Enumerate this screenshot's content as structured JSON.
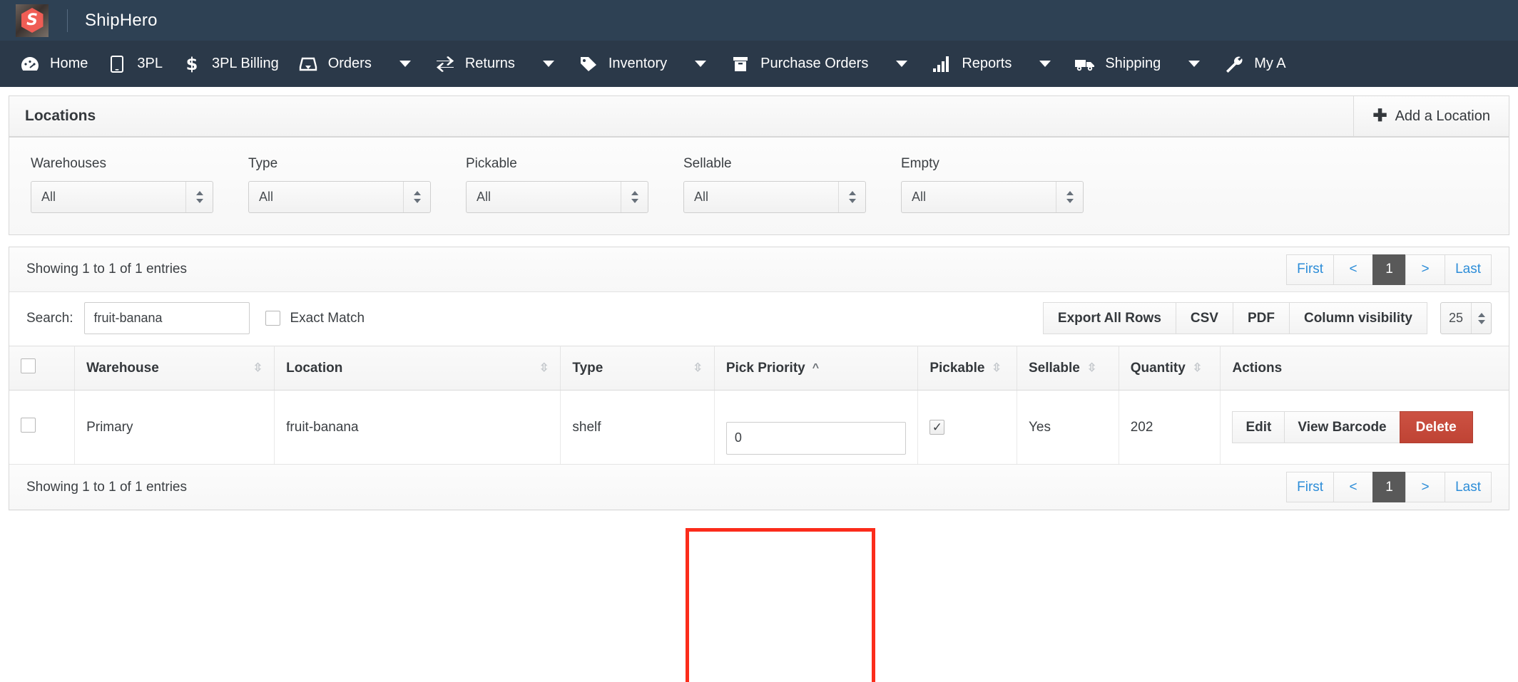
{
  "brand": {
    "name": "ShipHero",
    "logo_glyph": "S"
  },
  "nav": {
    "items": [
      {
        "label": "Home",
        "icon": "dashboard-icon",
        "caret": false
      },
      {
        "label": "3PL",
        "icon": "tablet-icon",
        "caret": false
      },
      {
        "label": "3PL Billing",
        "icon": "dollar-icon",
        "caret": false
      },
      {
        "label": "Orders",
        "icon": "inbox-icon",
        "caret": true
      },
      {
        "label": "Returns",
        "icon": "exchange-icon",
        "caret": true
      },
      {
        "label": "Inventory",
        "icon": "tag-icon",
        "caret": true
      },
      {
        "label": "Purchase Orders",
        "icon": "box-icon",
        "caret": true
      },
      {
        "label": "Reports",
        "icon": "bar-chart-icon",
        "caret": true
      },
      {
        "label": "Shipping",
        "icon": "truck-icon",
        "caret": true
      },
      {
        "label": "My A",
        "icon": "wrench-icon",
        "caret": false
      }
    ]
  },
  "panel": {
    "title": "Locations",
    "add_button": "Add a Location",
    "add_icon": "plus-icon"
  },
  "filters": [
    {
      "label": "Warehouses",
      "value": "All",
      "name": "warehouses-filter"
    },
    {
      "label": "Type",
      "value": "All",
      "name": "type-filter"
    },
    {
      "label": "Pickable",
      "value": "All",
      "name": "pickable-filter"
    },
    {
      "label": "Sellable",
      "value": "All",
      "name": "sellable-filter"
    },
    {
      "label": "Empty",
      "value": "All",
      "name": "empty-filter"
    }
  ],
  "table_meta": {
    "entries_top": "Showing 1 to 1 of 1 entries",
    "entries_bottom": "Showing 1 to 1 of 1 entries",
    "search_label": "Search:",
    "search_value": "fruit-banana",
    "search_placeholder": "",
    "exact_match_label": "Exact Match",
    "exact_match_checked": false,
    "page_length": "25"
  },
  "pagination": {
    "first": "First",
    "prev": "<",
    "current": "1",
    "next": ">",
    "last": "Last"
  },
  "export_buttons": [
    {
      "label": "Export All Rows",
      "name": "export-all-rows-button"
    },
    {
      "label": "CSV",
      "name": "export-csv-button"
    },
    {
      "label": "PDF",
      "name": "export-pdf-button"
    },
    {
      "label": "Column visibility",
      "name": "column-visibility-button"
    }
  ],
  "columns": [
    {
      "label": "Warehouse",
      "sort": "both"
    },
    {
      "label": "Location",
      "sort": "both"
    },
    {
      "label": "Type",
      "sort": "both"
    },
    {
      "label": "Pick Priority",
      "sort": "asc"
    },
    {
      "label": "Pickable",
      "sort": "both"
    },
    {
      "label": "Sellable",
      "sort": "both"
    },
    {
      "label": "Quantity",
      "sort": "both"
    },
    {
      "label": "Actions",
      "sort": "none"
    }
  ],
  "row": {
    "warehouse": "Primary",
    "location": "fruit-banana",
    "type": "shelf",
    "pick_priority": "0",
    "pickable_checked": true,
    "sellable": "Yes",
    "quantity": "202",
    "actions": {
      "edit": "Edit",
      "view_barcode": "View Barcode",
      "delete": "Delete"
    }
  },
  "colors": {
    "brandbar": "#2e4154",
    "navbar": "#2b3949",
    "accent_red": "#ef5d55",
    "link_blue": "#2d8dd8",
    "active_page": "#595959",
    "delete_button": "#c4493a",
    "highlight_box": "#fb2c1b"
  }
}
